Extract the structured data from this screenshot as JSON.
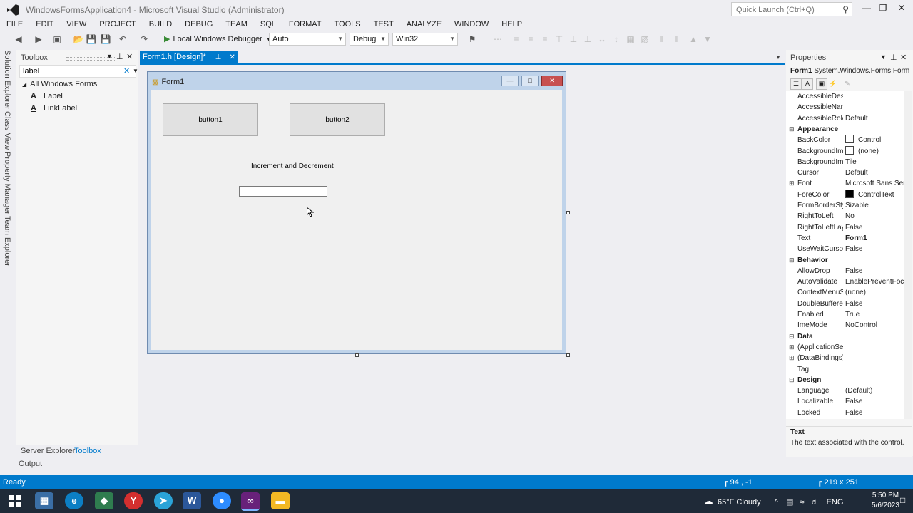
{
  "window": {
    "title": "WindowsFormsApplication4 - Microsoft Visual Studio (Administrator)",
    "quick_launch_placeholder": "Quick Launch (Ctrl+Q)",
    "accent": "#007acc"
  },
  "menu": [
    "FILE",
    "EDIT",
    "VIEW",
    "PROJECT",
    "BUILD",
    "DEBUG",
    "TEAM",
    "SQL",
    "FORMAT",
    "TOOLS",
    "TEST",
    "ANALYZE",
    "WINDOW",
    "HELP"
  ],
  "toolbar": {
    "debugger": "Local Windows Debugger",
    "solution_config_box": "Auto",
    "config": "Debug",
    "platform": "Win32"
  },
  "side_tabs": [
    "Solution Explorer",
    "Class View",
    "Property Manager",
    "Team Explorer"
  ],
  "toolbox": {
    "title": "Toolbox",
    "search_value": "label",
    "group": "All Windows Forms",
    "items": [
      "Label",
      "LinkLabel"
    ],
    "bottom_tabs": [
      "Server Explorer",
      "Toolbox"
    ]
  },
  "document_tab": "Form1.h [Design]*",
  "form": {
    "title": "Form1",
    "button1": "button1",
    "button2": "button2",
    "label": "Increment and Decrement"
  },
  "properties": {
    "title": "Properties",
    "object_name": "Form1",
    "object_type": "System.Windows.Forms.Form",
    "rows": [
      {
        "name": "AccessibleDescription",
        "value": ""
      },
      {
        "name": "AccessibleName",
        "value": ""
      },
      {
        "name": "AccessibleRole",
        "value": "Default"
      },
      {
        "category": "Appearance"
      },
      {
        "name": "BackColor",
        "value": "Control",
        "swatch": "#ffffff"
      },
      {
        "name": "BackgroundImage",
        "value": "(none)",
        "swatch": "#ffffff"
      },
      {
        "name": "BackgroundImageLayout",
        "value": "Tile"
      },
      {
        "name": "Cursor",
        "value": "Default"
      },
      {
        "name": "Font",
        "value": "Microsoft Sans Serif",
        "expand": true
      },
      {
        "name": "ForeColor",
        "value": "ControlText",
        "swatch": "#000000"
      },
      {
        "name": "FormBorderStyle",
        "value": "Sizable"
      },
      {
        "name": "RightToLeft",
        "value": "No"
      },
      {
        "name": "RightToLeftLayout",
        "value": "False"
      },
      {
        "name": "Text",
        "value": "Form1",
        "bold": true
      },
      {
        "name": "UseWaitCursor",
        "value": "False"
      },
      {
        "category": "Behavior"
      },
      {
        "name": "AllowDrop",
        "value": "False"
      },
      {
        "name": "AutoValidate",
        "value": "EnablePreventFocusChange"
      },
      {
        "name": "ContextMenuStrip",
        "value": "(none)"
      },
      {
        "name": "DoubleBuffered",
        "value": "False"
      },
      {
        "name": "Enabled",
        "value": "True"
      },
      {
        "name": "ImeMode",
        "value": "NoControl"
      },
      {
        "category": "Data"
      },
      {
        "name": "(ApplicationSettings)",
        "value": "",
        "expand": true
      },
      {
        "name": "(DataBindings)",
        "value": "",
        "expand": true
      },
      {
        "name": "Tag",
        "value": ""
      },
      {
        "category": "Design"
      },
      {
        "name": "Language",
        "value": "(Default)"
      },
      {
        "name": "Localizable",
        "value": "False"
      },
      {
        "name": "Locked",
        "value": "False"
      }
    ],
    "desc_title": "Text",
    "desc_text": "The text associated with the control."
  },
  "output_tab": "Output",
  "status": {
    "ready": "Ready",
    "position": "94 , -1",
    "size": "219 x 251"
  },
  "taskbar": {
    "weather": "65°F  Cloudy",
    "language": "ENG",
    "time": "5:50 PM",
    "date": "5/6/2023"
  }
}
